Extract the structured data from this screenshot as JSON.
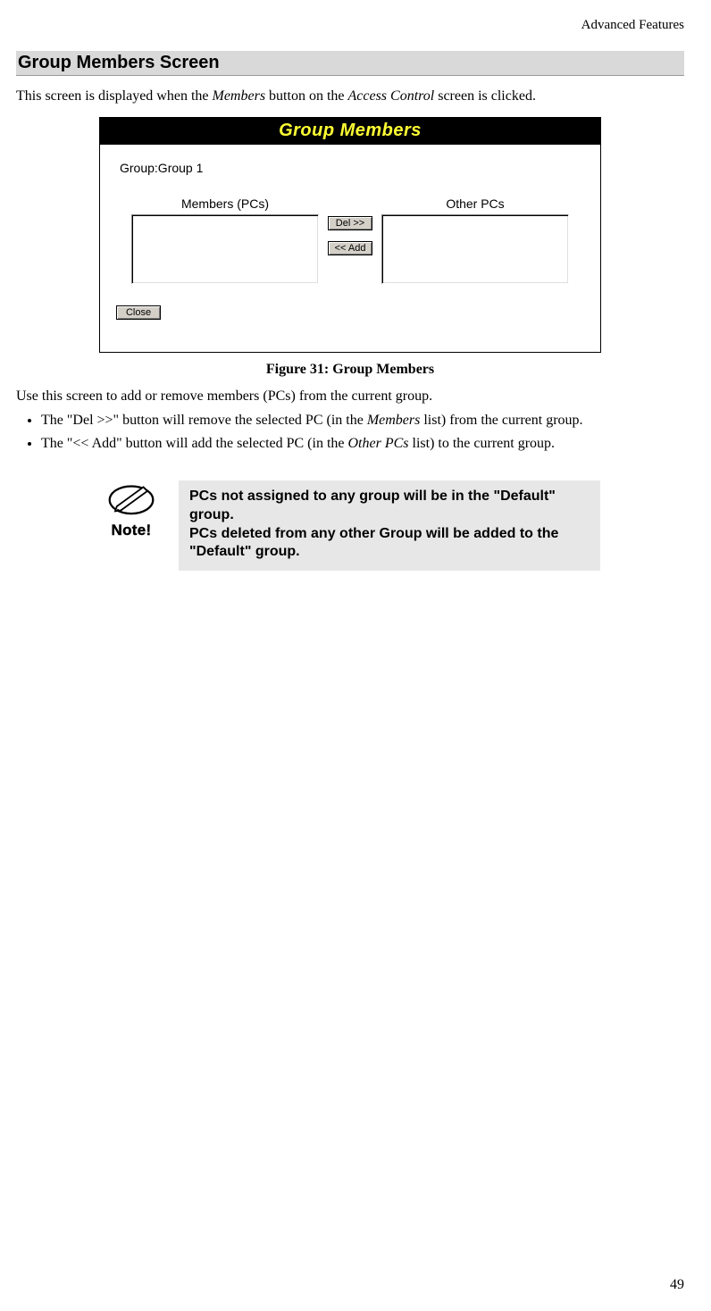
{
  "header": {
    "running": "Advanced Features"
  },
  "section": {
    "heading": "Group Members Screen"
  },
  "intro": {
    "pre": "This screen is displayed when the ",
    "em1": "Members",
    "mid": " button on the ",
    "em2": "Access Control",
    "post": " screen is clicked."
  },
  "screenshot": {
    "title": "Group Members",
    "group_label": "Group:Group 1",
    "members_label": "Members (PCs)",
    "others_label": "Other PCs",
    "btn_del": "Del >>",
    "btn_add": "<< Add",
    "btn_close": "Close"
  },
  "figure_caption": "Figure 31: Group Members",
  "usage_para": "Use this screen to add or remove members (PCs) from the current group.",
  "bullets": {
    "b1_pre": "The \"Del >>\" button will remove the selected PC (in the ",
    "b1_em": "Members",
    "b1_post": " list) from the current group.",
    "b2_pre": "The \"<< Add\" button will add the selected PC (in the ",
    "b2_em": "Other PCs",
    "b2_post": " list) to the current group."
  },
  "note": {
    "label": "Note!",
    "line1": "PCs not assigned to any group will be in the \"Default\" group.",
    "line2": "PCs deleted from any other Group will be added to the \"Default\" group."
  },
  "page_number": "49"
}
